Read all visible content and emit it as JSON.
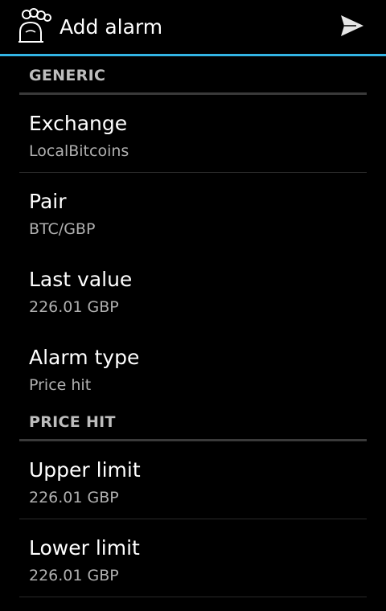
{
  "action_bar": {
    "title": "Add alarm",
    "app_icon": "alarm-clock-icon",
    "send_icon": "send-icon",
    "accent_color": "#33b5e5"
  },
  "sections": [
    {
      "header": "GENERIC",
      "items": [
        {
          "title": "Exchange",
          "summary": "LocalBitcoins"
        },
        {
          "title": "Pair",
          "summary": "BTC/GBP"
        },
        {
          "title": "Last value",
          "summary": "226.01 GBP"
        },
        {
          "title": "Alarm type",
          "summary": "Price hit"
        }
      ]
    },
    {
      "header": "PRICE HIT",
      "items": [
        {
          "title": "Upper limit",
          "summary": "226.01 GBP"
        },
        {
          "title": "Lower limit",
          "summary": "226.01 GBP"
        }
      ]
    }
  ]
}
